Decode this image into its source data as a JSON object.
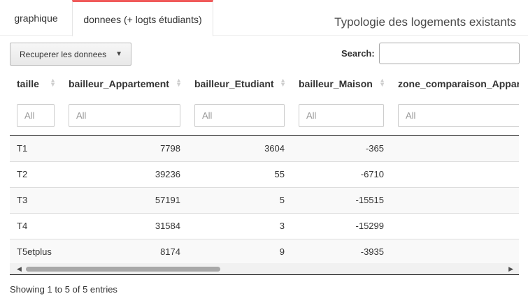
{
  "tabs": {
    "graphique": "graphique",
    "donnees": "donnees (+ logts étudiants)"
  },
  "page_title": "Typologie des logements existants",
  "toolbar": {
    "recup_label": "Recuperer les donnees",
    "caret": "▼"
  },
  "search": {
    "label": "Search:",
    "value": ""
  },
  "table": {
    "columns": [
      "taille",
      "bailleur_Appartement",
      "bailleur_Etudiant",
      "bailleur_Maison",
      "zone_comparaison_Appar"
    ],
    "filter_placeholder": "All",
    "rows": [
      [
        "T1",
        "7798",
        "3604",
        "-365",
        ""
      ],
      [
        "T2",
        "39236",
        "55",
        "-6710",
        ""
      ],
      [
        "T3",
        "57191",
        "5",
        "-15515",
        ""
      ],
      [
        "T4",
        "31584",
        "3",
        "-15299",
        ""
      ],
      [
        "T5etplus",
        "8174",
        "9",
        "-3935",
        ""
      ]
    ]
  },
  "scroll": {
    "left": "◀",
    "right": "▶"
  },
  "sort_icons": {
    "up": "▲",
    "down": "▼"
  },
  "info": "Showing 1 to 5 of 5 entries"
}
